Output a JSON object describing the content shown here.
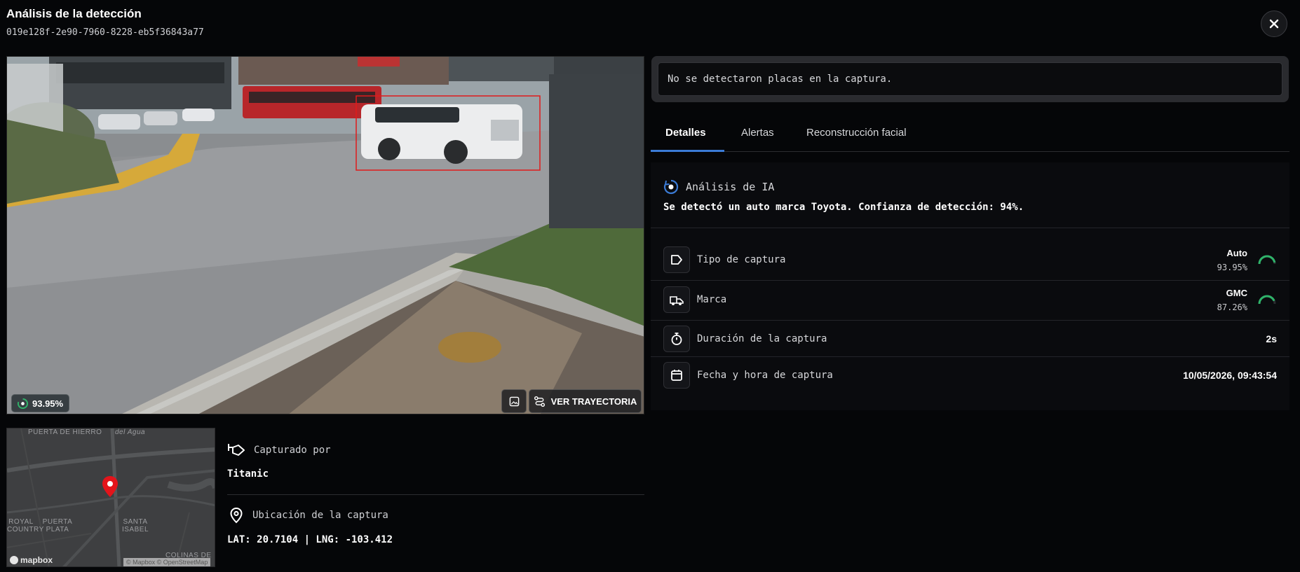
{
  "header": {
    "title": "Análisis de la detección",
    "detection_id": "019e128f-2e90-7960-8228-eb5f36843a77"
  },
  "image": {
    "confidence": "93.95%",
    "trajectory_button": "VER TRAYECTORIA",
    "bounding_box_color": "#e01b1b"
  },
  "map": {
    "labels": [
      "PUERTA DE HIERRO",
      "del Agua",
      "ROYAL COUNTRY",
      "PUERTA PLATA",
      "SANTA ISABEL",
      "COLINAS DE"
    ],
    "logo": "mapbox",
    "attribution": "© Mapbox © OpenStreetMap",
    "pin_color": "#e3141b"
  },
  "capture": {
    "captured_by_label": "Capturado por",
    "captured_by_value": "Titanic",
    "location_label": "Ubicación de la captura",
    "location_value": "LAT: 20.7104 | LNG: -103.412"
  },
  "plates": {
    "message": "No se detectaron placas en la captura."
  },
  "tabs": [
    {
      "label": "Detalles",
      "active": true
    },
    {
      "label": "Alertas",
      "active": false
    },
    {
      "label": "Reconstrucción facial",
      "active": false
    }
  ],
  "details": {
    "ai_heading": "Análisis de IA",
    "ai_text": "Se detectó un auto marca Toyota. Confianza de detección: 94%.",
    "rows": [
      {
        "label": "Tipo de captura",
        "value": "Auto",
        "percent": "93.95%",
        "icon": "tag-icon",
        "confidence": 0.9395
      },
      {
        "label": "Marca",
        "value": "GMC",
        "percent": "87.26%",
        "icon": "vehicle-icon",
        "confidence": 0.8726
      },
      {
        "label": "Duración de la captura",
        "value": "2s",
        "icon": "stopwatch-icon"
      },
      {
        "label": "Fecha y hora de captura",
        "value": "10/05/2026, 09:43:54",
        "icon": "calendar-icon"
      }
    ]
  },
  "colors": {
    "accent_blue": "#3b7bd6",
    "gauge_green": "#2fb36a"
  }
}
